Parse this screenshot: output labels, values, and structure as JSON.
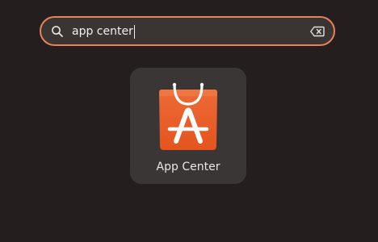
{
  "search": {
    "query": "app center"
  },
  "results": [
    {
      "label": "App Center",
      "icon": "app-center-shopping-bag-icon"
    }
  ],
  "colors": {
    "background": "#241f1e",
    "search_border": "#e8825c",
    "search_fill": "#3a3432",
    "tile_fill": "#3a3635",
    "app_icon_orange": "#e95420"
  }
}
